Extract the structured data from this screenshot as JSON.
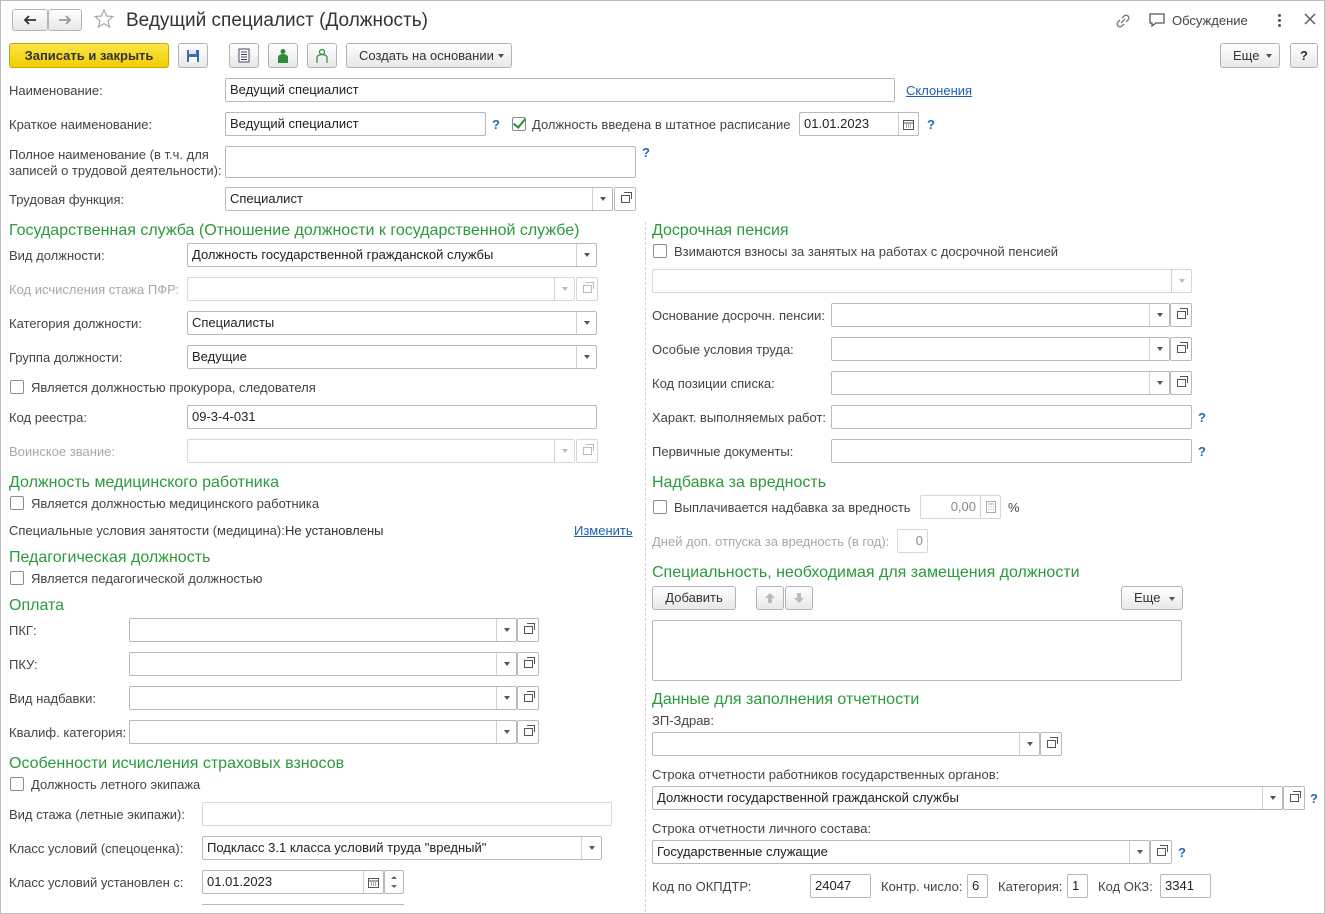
{
  "header": {
    "title": "Ведущий специалист (Должность)",
    "discussion": "Обсуждение"
  },
  "toolbar": {
    "save_close": "Записать и закрыть",
    "create_based": "Создать на основании",
    "more": "Еще",
    "help": "?"
  },
  "top": {
    "name_label": "Наименование:",
    "name_value": "Ведущий специалист",
    "declensions_link": "Склонения",
    "short_label": "Краткое наименование:",
    "short_value": "Ведущий специалист",
    "staff_checkbox_label": "Должность введена в штатное расписание",
    "staff_checked": true,
    "staff_date": "01.01.2023",
    "full_label_1": "Полное наименование (в т.ч. для",
    "full_label_2": "записей о трудовой деятельности):",
    "full_value": "",
    "labor_func_label": "Трудовая функция:",
    "labor_func_value": "Специалист",
    "q": "?"
  },
  "left": {
    "gov_title": "Государственная служба (Отношение должности к государственной службе)",
    "pos_type_label": "Вид должности:",
    "pos_type_value": "Должность государственной гражданской службы",
    "pfr_label": "Код исчисления стажа ПФР:",
    "pfr_value": "",
    "category_label": "Категория должности:",
    "category_value": "Специалисты",
    "group_label": "Группа должности:",
    "group_value": "Ведущие",
    "prosecutor_label": "Является должностью прокурора, следователя",
    "registry_label": "Код реестра:",
    "registry_value": "09-3-4-031",
    "military_label": "Воинское звание:",
    "military_value": "",
    "med_title": "Должность медицинского работника",
    "med_checkbox": "Является должностью медицинского работника",
    "med_special_label": "Специальные условия занятости (медицина):",
    "med_special_value": "Не установлены",
    "med_change_link": "Изменить",
    "ped_title": "Педагогическая должность",
    "ped_checkbox": "Является педагогической должностью",
    "pay_title": "Оплата",
    "pkg_label": "ПКГ:",
    "pku_label": "ПКУ:",
    "bonus_type_label": "Вид надбавки:",
    "qual_label": "Квалиф. категория:",
    "ins_title": "Особенности исчисления страховых взносов",
    "flight_checkbox": "Должность летного экипажа",
    "flight_exp_label": "Вид стажа (летные экипажи):",
    "cond_class_label": "Класс условий (спецоценка):",
    "cond_class_value": "Подкласс 3.1 класса условий труда \"вредный\"",
    "cond_date_label": "Класс условий установлен с:",
    "cond_date_value": "01.01.2023"
  },
  "right": {
    "early_title": "Досрочная пенсия",
    "early_checkbox": "Взимаются взносы за занятых на работах с досрочной пенсией",
    "early_basis_label": "Основание досрочн. пенсии:",
    "special_cond_label": "Особые условия труда:",
    "list_pos_label": "Код позиции списка:",
    "work_char_label": "Характ. выполняемых работ:",
    "primary_docs_label": "Первичные документы:",
    "harm_title": "Надбавка за вредность",
    "harm_checkbox": "Выплачивается надбавка за вредность",
    "harm_value": "0,00",
    "harm_unit": "%",
    "harm_days_label": "Дней доп. отпуска за вредность (в год):",
    "harm_days_value": "0",
    "spec_title": "Специальность, необходимая для замещения должности",
    "add_btn": "Добавить",
    "more_btn": "Еще",
    "report_title": "Данные для заполнения отчетности",
    "zp_label": "ЗП-Здрав:",
    "gov_report_label": "Строка отчетности работников государственных органов:",
    "gov_report_value": "Должности государственной гражданской службы",
    "staff_report_label": "Строка отчетности личного состава:",
    "staff_report_value": "Государственные служащие",
    "okpdtr_label": "Код по ОКПДТР:",
    "okpdtr_value": "24047",
    "control_label": "Контр. число:",
    "control_value": "6",
    "cat_label": "Категория:",
    "cat_value": "1",
    "okz_label": "Код ОКЗ:",
    "okz_value": "3341"
  },
  "colors": {
    "accent_green": "#2b9a3a",
    "primary_yellow": "#f1ce00",
    "link_blue": "#1f5fae"
  }
}
